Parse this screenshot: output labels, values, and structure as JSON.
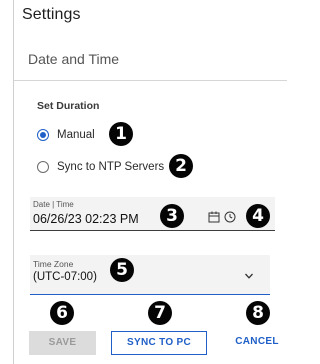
{
  "window": {
    "title": "Settings"
  },
  "section": {
    "title": "Date and Time"
  },
  "duration": {
    "heading": "Set Duration",
    "options": [
      {
        "label": "Manual",
        "selected": true
      },
      {
        "label": "Sync to NTP Servers",
        "selected": false
      }
    ]
  },
  "datetime_field": {
    "label": "Date | Time",
    "value": "06/26/23 02:23 PM",
    "icons": [
      "calendar-icon",
      "clock-icon"
    ]
  },
  "timezone_field": {
    "label": "Time Zone",
    "value": "(UTC-07:00)",
    "icon": "chevron-down-icon"
  },
  "buttons": {
    "save": "SAVE",
    "sync": "SYNC TO PC",
    "cancel": "CANCEL"
  },
  "callouts": [
    "1",
    "2",
    "3",
    "4",
    "5",
    "6",
    "7",
    "8"
  ],
  "colors": {
    "accent": "#1f5fc7",
    "callout_bg": "#050505",
    "field_bg": "#f3f3f3",
    "disabled_bg": "#dcdcdc"
  }
}
